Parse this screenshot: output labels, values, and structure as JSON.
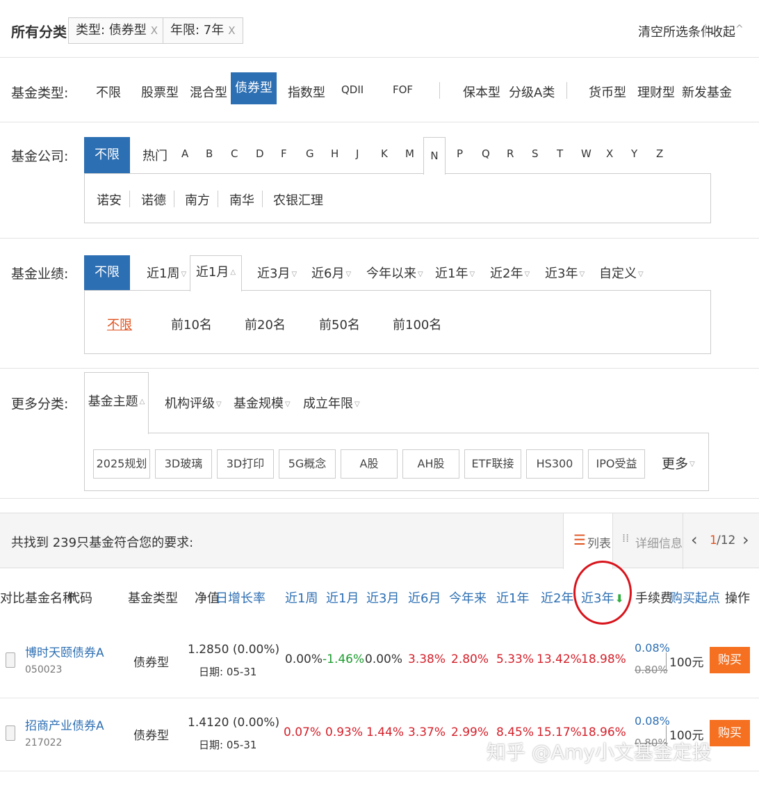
{
  "crumb": {
    "root": "所有分类",
    "tags": [
      {
        "text": "类型: 债券型",
        "close": "X"
      },
      {
        "text": "年限: 7年",
        "close": "X"
      }
    ],
    "clear": "清空所选条件",
    "collapse": "收起",
    "collapse_caret": "^"
  },
  "fund_type": {
    "label": "基金类型:",
    "options": [
      "不限",
      "股票型",
      "混合型",
      "债券型",
      "指数型",
      "QDII",
      "FOF",
      "保本型",
      "分级A类",
      "货币型",
      "理财型",
      "新发基金"
    ],
    "selected": "债券型"
  },
  "company": {
    "label": "基金公司:",
    "all": "不限",
    "letters": [
      "热门",
      "A",
      "B",
      "C",
      "D",
      "F",
      "G",
      "H",
      "J",
      "K",
      "M",
      "N",
      "P",
      "Q",
      "R",
      "S",
      "T",
      "W",
      "X",
      "Y",
      "Z"
    ],
    "active_letter": "N",
    "companies": [
      "诺安",
      "诺德",
      "南方",
      "南华",
      "农银汇理"
    ]
  },
  "performance": {
    "label": "基金业绩:",
    "all": "不限",
    "periods": [
      "近1周",
      "近1月",
      "近3月",
      "近6月",
      "今年以来",
      "近1年",
      "近2年",
      "近3年",
      "自定义"
    ],
    "active_period": "近1月",
    "ranks": [
      "不限",
      "前10名",
      "前20名",
      "前50名",
      "前100名"
    ]
  },
  "more": {
    "label": "更多分类:",
    "tabs": [
      "基金主题",
      "机构评级",
      "基金规模",
      "成立年限"
    ],
    "themes": [
      "2025规划",
      "3D玻璃",
      "3D打印",
      "5G概念",
      "A股",
      "AH股",
      "ETF联接",
      "HS300",
      "IPO受益"
    ],
    "more_link": "更多"
  },
  "results": {
    "summary": "共找到 239只基金符合您的要求:",
    "view_list": "列表",
    "view_detail": "详细信息",
    "page_current": "1",
    "page_total": "/12",
    "prev": "‹",
    "next": "›"
  },
  "table": {
    "headers": {
      "compare": "对比",
      "name": "基金名称",
      "code": "代码",
      "type": "基金类型",
      "nav": "净值",
      "growth": "日增长率",
      "w1": "近1周",
      "m1": "近1月",
      "m3": "近3月",
      "m6": "近6月",
      "ytd": "今年来",
      "y1": "近1年",
      "y2": "近2年",
      "y3": "近3年",
      "fee": "手续费",
      "min": "购买起点",
      "op": "操作"
    },
    "rows": [
      {
        "name": "博时天颐债券A",
        "code": "050023",
        "type": "债券型",
        "nav": "1.2850 (0.00%)",
        "date": "日期: 05-31",
        "w1": "0.00%",
        "m1": "-1.46%",
        "m3": "0.00%",
        "m6": "3.38%",
        "ytd": "2.80%",
        "y1": "5.33%",
        "y2": "13.42%",
        "y3": "18.98%",
        "fee": "0.08%",
        "fee_old": "0.80%",
        "min": "100元",
        "buy": "购买"
      },
      {
        "name": "招商产业债券A",
        "code": "217022",
        "type": "债券型",
        "nav": "1.4120 (0.00%)",
        "date": "日期: 05-31",
        "w1": "0.07%",
        "m1": "0.93%",
        "m3": "1.44%",
        "m6": "3.37%",
        "ytd": "2.99%",
        "y1": "8.45%",
        "y2": "15.17%",
        "y3": "18.96%",
        "fee": "0.08%",
        "fee_old": "0.80%",
        "min": "100元",
        "buy": "购买"
      }
    ]
  },
  "watermark": "知乎 @Amy小文基金定投",
  "colors": {
    "accent": "#2d6fb3",
    "buy": "#f57020",
    "up": "#d4202a",
    "down": "#1c9b2e",
    "highlight_circle": "#d8141c"
  }
}
